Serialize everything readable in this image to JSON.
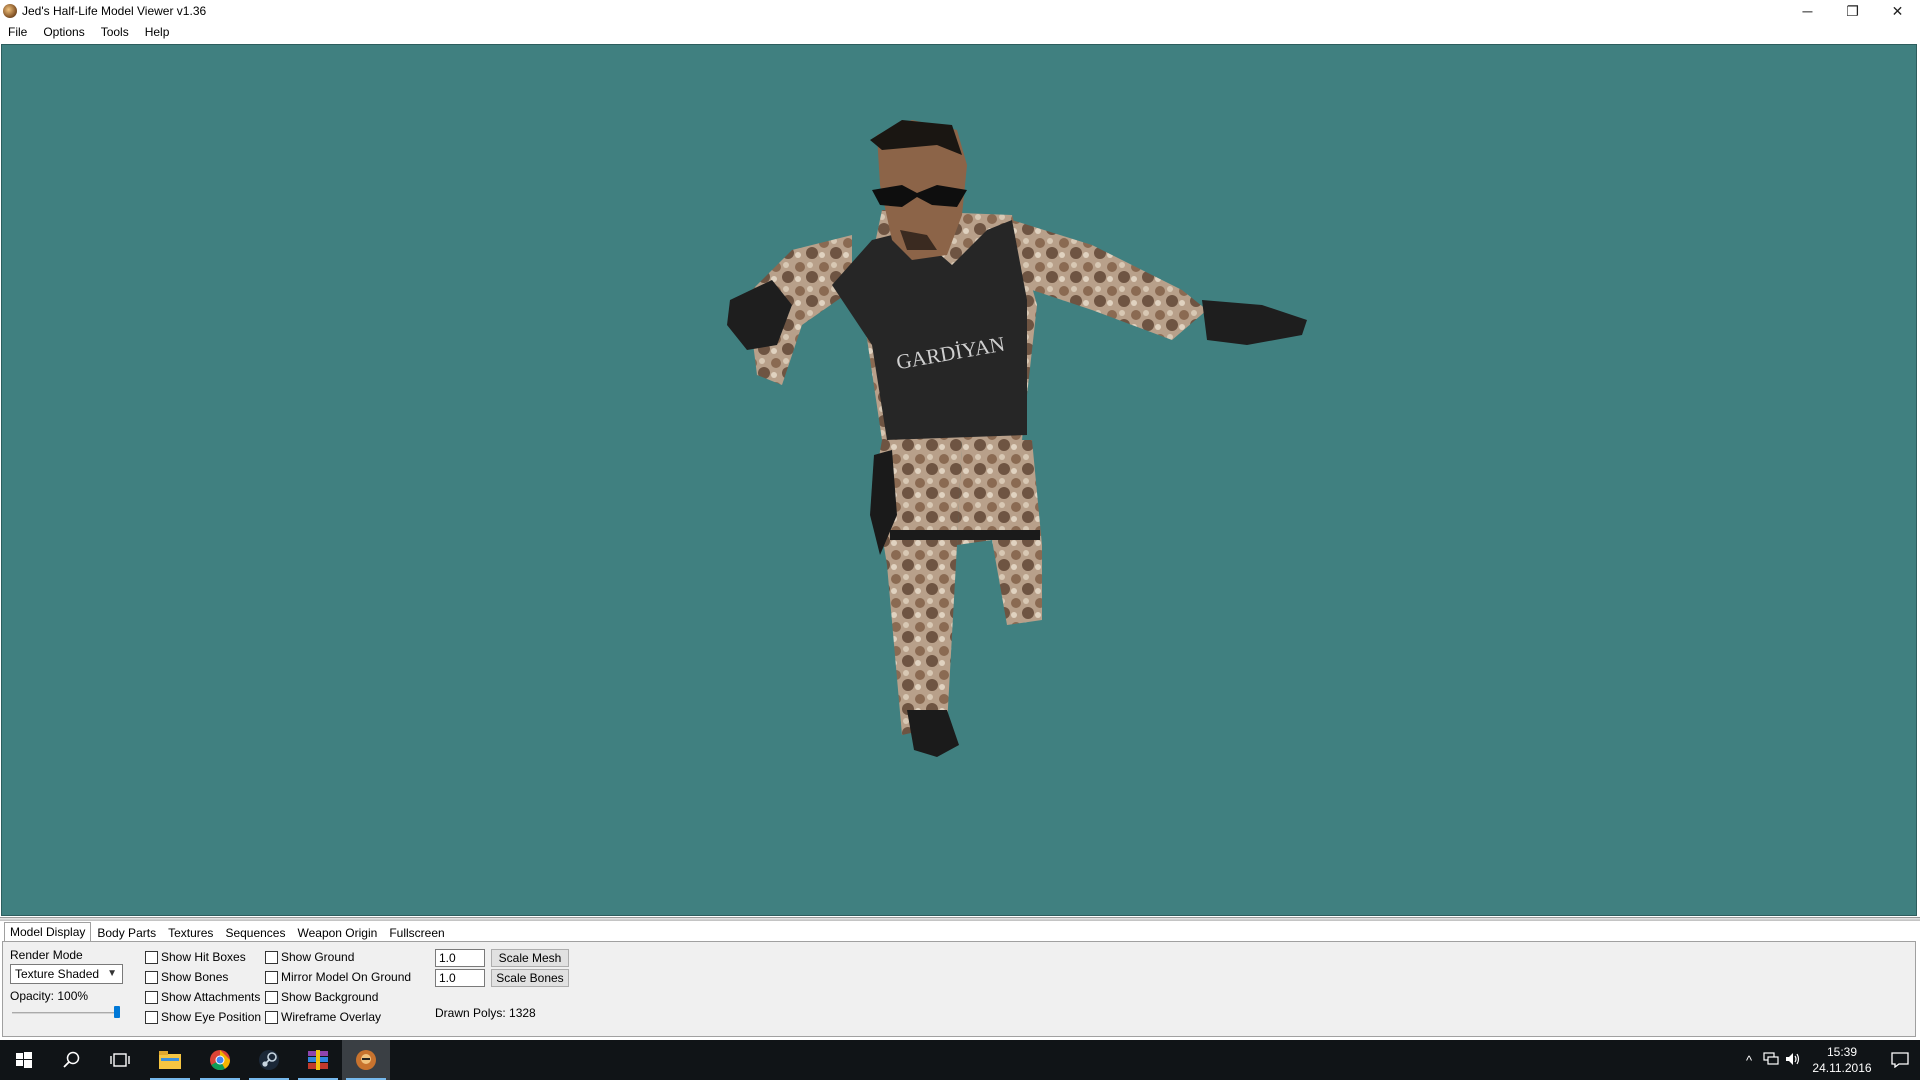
{
  "window": {
    "title": "Jed's Half-Life Model Viewer v1.36",
    "controls": {
      "minimize": "─",
      "restore": "❐",
      "close": "✕"
    }
  },
  "menu": [
    "File",
    "Options",
    "Tools",
    "Help"
  ],
  "viewport": {
    "background_color": "#408080",
    "model_text": "GARDİYAN"
  },
  "tabs": [
    {
      "label": "Model Display",
      "active": true
    },
    {
      "label": "Body Parts",
      "active": false
    },
    {
      "label": "Textures",
      "active": false
    },
    {
      "label": "Sequences",
      "active": false
    },
    {
      "label": "Weapon Origin",
      "active": false
    },
    {
      "label": "Fullscreen",
      "active": false
    }
  ],
  "model_display": {
    "render_mode_label": "Render Mode",
    "render_mode_value": "Texture Shaded",
    "opacity_label": "Opacity: 100%",
    "opacity_value": 100,
    "checkboxes_col1": [
      "Show Hit Boxes",
      "Show Bones",
      "Show Attachments",
      "Show Eye Position"
    ],
    "checkboxes_col2": [
      "Show Ground",
      "Mirror Model On Ground",
      "Show Background",
      "Wireframe Overlay"
    ],
    "scale_mesh_value": "1.0",
    "scale_mesh_label": "Scale Mesh",
    "scale_bones_value": "1.0",
    "scale_bones_label": "Scale Bones",
    "drawn_polys": "Drawn Polys: 1328"
  },
  "taskbar": {
    "icons": [
      "windows-start-icon",
      "search-icon",
      "task-view-icon",
      "file-explorer-icon",
      "chrome-icon",
      "steam-icon",
      "winrar-icon",
      "hlmv-icon"
    ],
    "tray_icons": [
      "^",
      "network-icon",
      "volume-icon"
    ],
    "time": "15:39",
    "date": "24.11.2016"
  }
}
